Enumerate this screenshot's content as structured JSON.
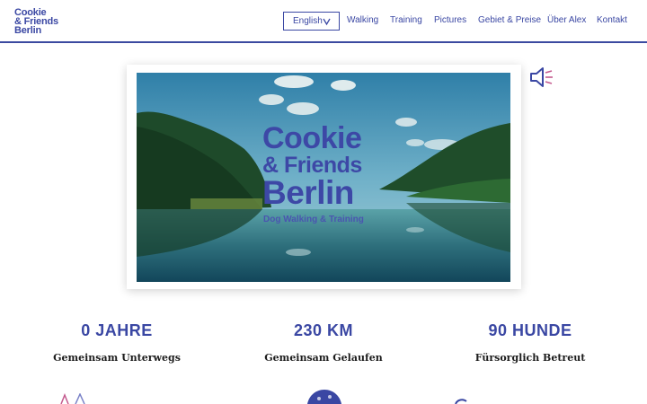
{
  "header": {
    "logo_lines": [
      "Cookie",
      "& Friends",
      "Berlin"
    ],
    "language": "English",
    "nav": [
      "Walking",
      "Training",
      "Pictures",
      "Gebiet & Preise",
      "Über Alex",
      "Kontakt"
    ]
  },
  "hero": {
    "title_line1": "Cookie",
    "title_line2": "& Friends",
    "title_line3": "Berlin",
    "tagline": "Dog Walking & Training",
    "audio_icon": "speaker-muted-icon"
  },
  "stats": [
    {
      "value": "0 JAHRE",
      "label": "Gemeinsam Unterwegs"
    },
    {
      "value": "230 KM",
      "label": "Gemeinsam Gelaufen"
    },
    {
      "value": "90 HUNDE",
      "label": "Fürsorglich Betreut"
    }
  ],
  "colors": {
    "brand": "#3a47a3",
    "text": "#1d1d1d",
    "background": "#ffffff"
  }
}
